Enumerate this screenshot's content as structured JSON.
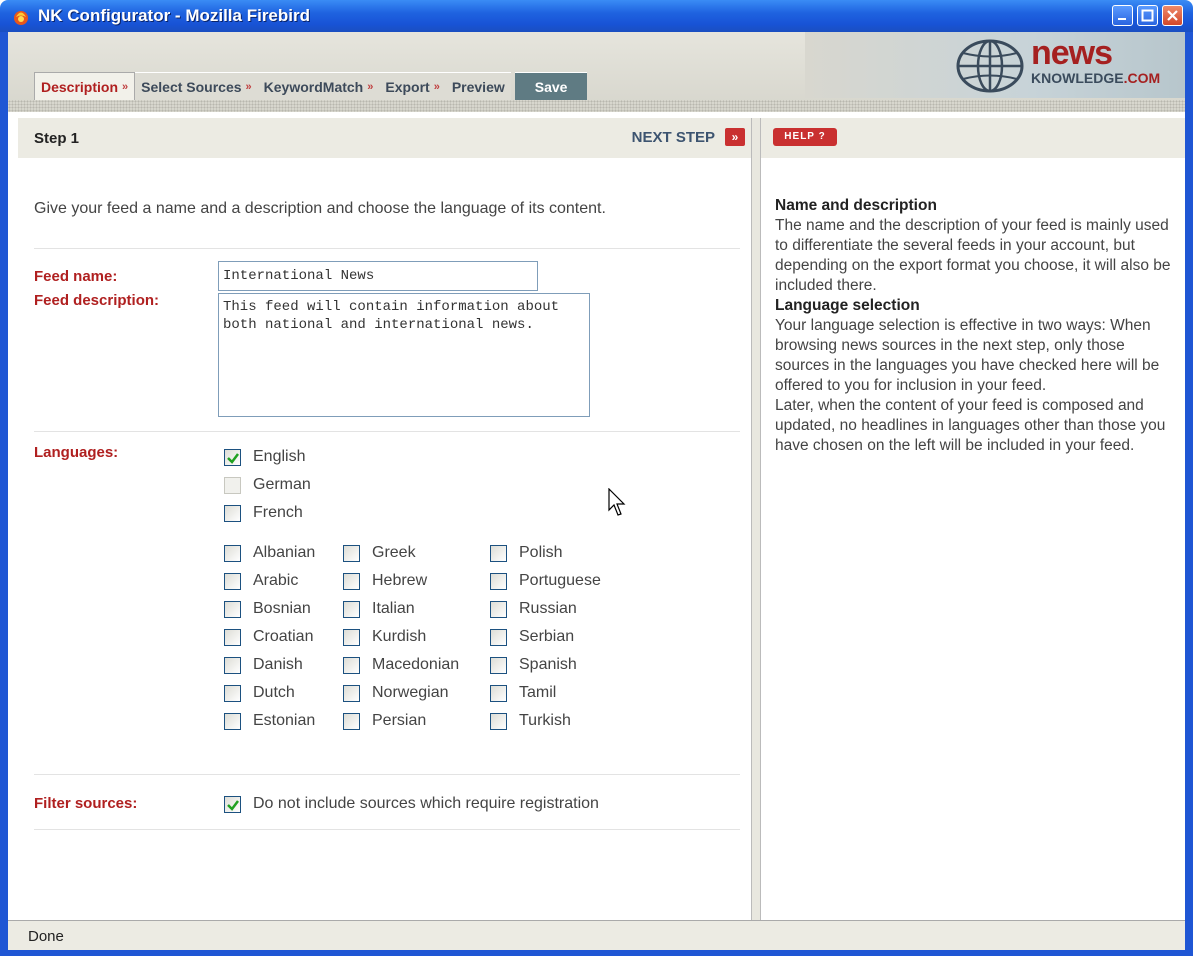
{
  "window": {
    "title": "NK Configurator - Mozilla Firebird"
  },
  "tabs": [
    {
      "label": "Description",
      "active": true
    },
    {
      "label": "Select Sources",
      "active": false
    },
    {
      "label": "KeywordMatch",
      "active": false
    },
    {
      "label": "Export",
      "active": false
    },
    {
      "label": "Preview",
      "active": false
    }
  ],
  "save_label": "Save",
  "logo": {
    "news": "news",
    "knowledge": "KNOWLEDGE",
    "com": ".COM"
  },
  "step": {
    "label": "Step 1",
    "next_label": "NEXT STEP",
    "next_icon": "»"
  },
  "intro": "Give your feed a name and a description and choose the language of its content.",
  "form": {
    "feed_name_label": "Feed name:",
    "feed_name_value": "International News",
    "feed_desc_label": "Feed description:",
    "feed_desc_value": "This feed will contain information about both national and international news.",
    "languages_label": "Languages:",
    "filter_label": "Filter sources:",
    "filter_option": "Do not include sources which require registration",
    "filter_checked": true
  },
  "primary_languages": [
    {
      "name": "English",
      "checked": true,
      "disabled": false
    },
    {
      "name": "German",
      "checked": false,
      "disabled": true
    },
    {
      "name": "French",
      "checked": false,
      "disabled": false
    }
  ],
  "language_columns": [
    [
      "Albanian",
      "Arabic",
      "Bosnian",
      "Croatian",
      "Danish",
      "Dutch",
      "Estonian"
    ],
    [
      "Greek",
      "Hebrew",
      "Italian",
      "Kurdish",
      "Macedonian",
      "Norwegian",
      "Persian"
    ],
    [
      "Polish",
      "Portuguese",
      "Russian",
      "Serbian",
      "Spanish",
      "Tamil",
      "Turkish"
    ]
  ],
  "help": {
    "button": "HELP ?",
    "h1": "Name and description",
    "p1": "The name and the description of your feed is mainly used to differentiate the several feeds in your account, but depending on the export format you choose, it will also be included there.",
    "h2": "Language selection",
    "p2": "Your language selection is effective in two ways: When browsing news sources in the next step, only those sources in the languages you have checked here will be offered to you for inclusion in your feed.",
    "p3": "Later, when the content of your feed is composed and updated, no headlines in languages other than those you have chosen on the left will be included in your feed."
  },
  "status": "Done"
}
